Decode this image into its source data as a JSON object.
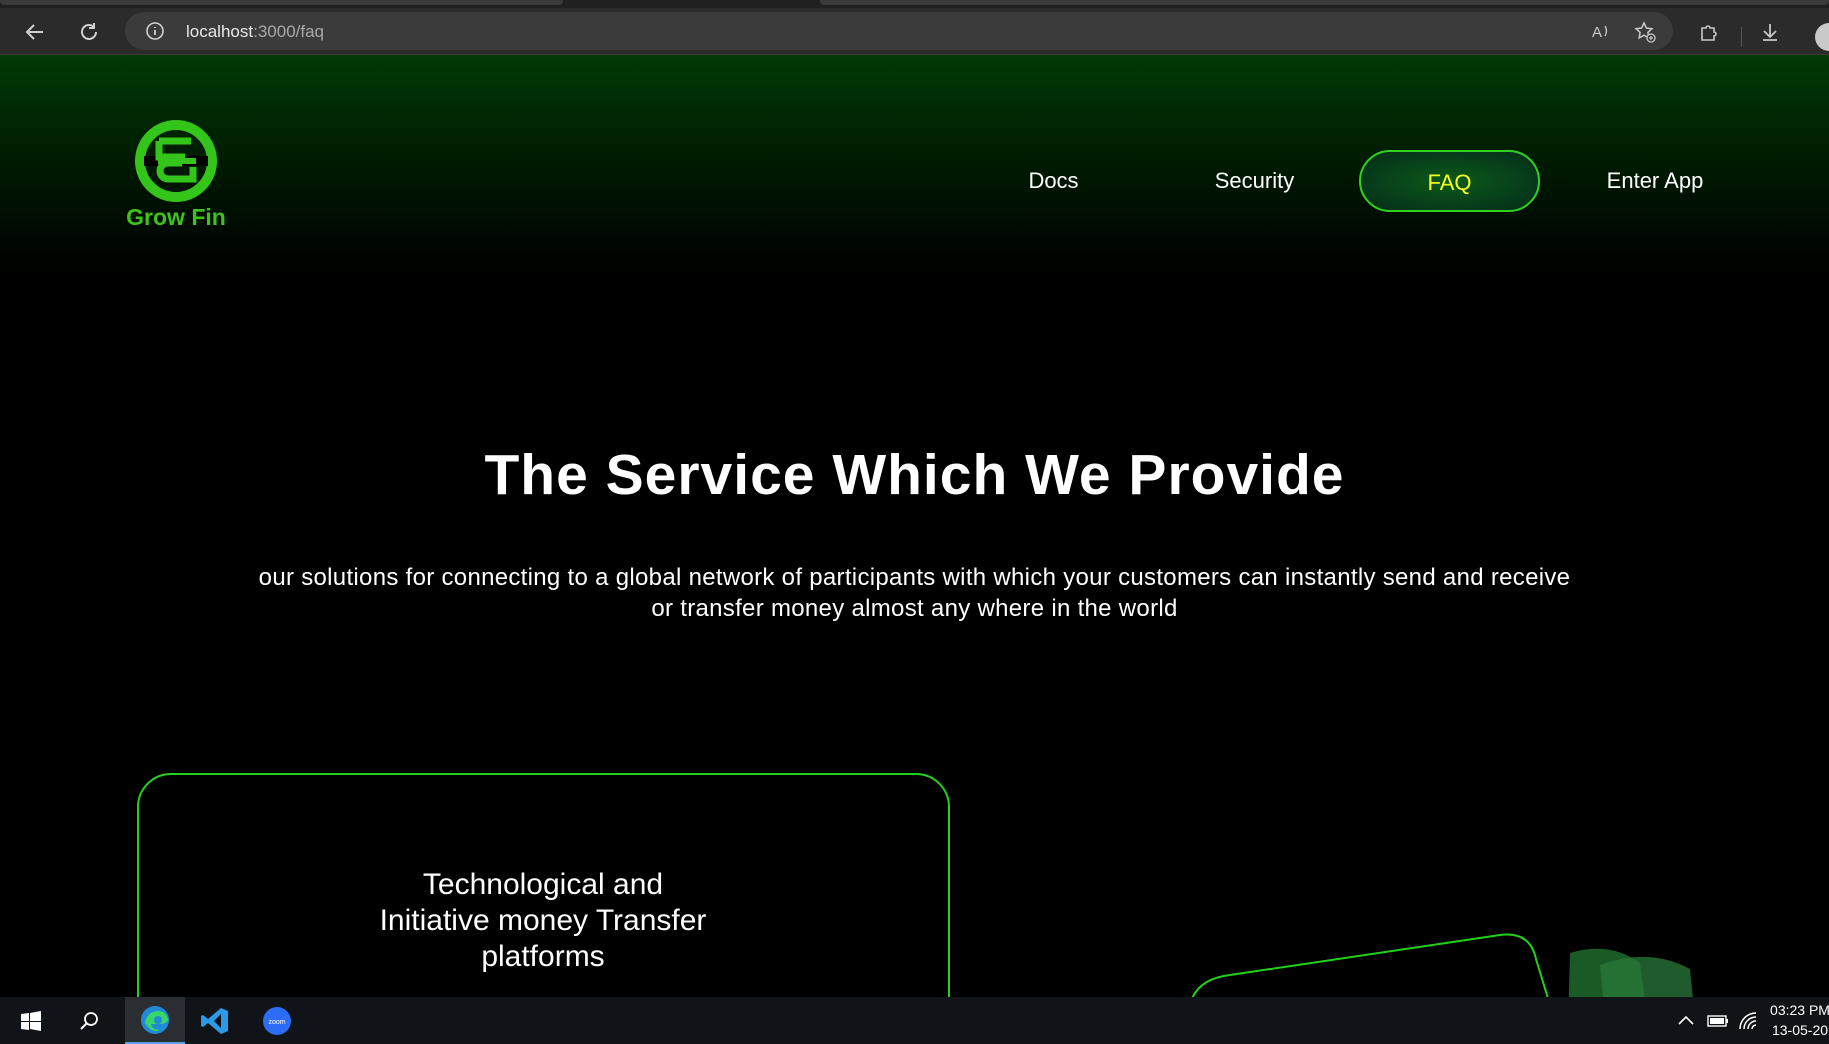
{
  "browser": {
    "url_host": "localhost",
    "url_path": ":3000/faq"
  },
  "brand": {
    "name": "Grow Fin",
    "color": "#3fc21a"
  },
  "nav": {
    "docs": "Docs",
    "security": "Security",
    "faq": "FAQ",
    "enter_app": "Enter App",
    "active": "faq"
  },
  "hero": {
    "title": "The Service Which We Provide",
    "subtitle": "our solutions for connecting to a global network of participants with which your customers can instantly send and receive or transfer money almost any where in the world"
  },
  "card": {
    "title_lines": [
      "Technological and",
      "Initiative money Transfer",
      "platforms"
    ]
  },
  "taskbar": {
    "time": "03:23 PM",
    "date": "13-05-20"
  },
  "colors": {
    "accent_green": "#22d11a",
    "faq_text": "#f4ff1a",
    "background": "#000000"
  }
}
